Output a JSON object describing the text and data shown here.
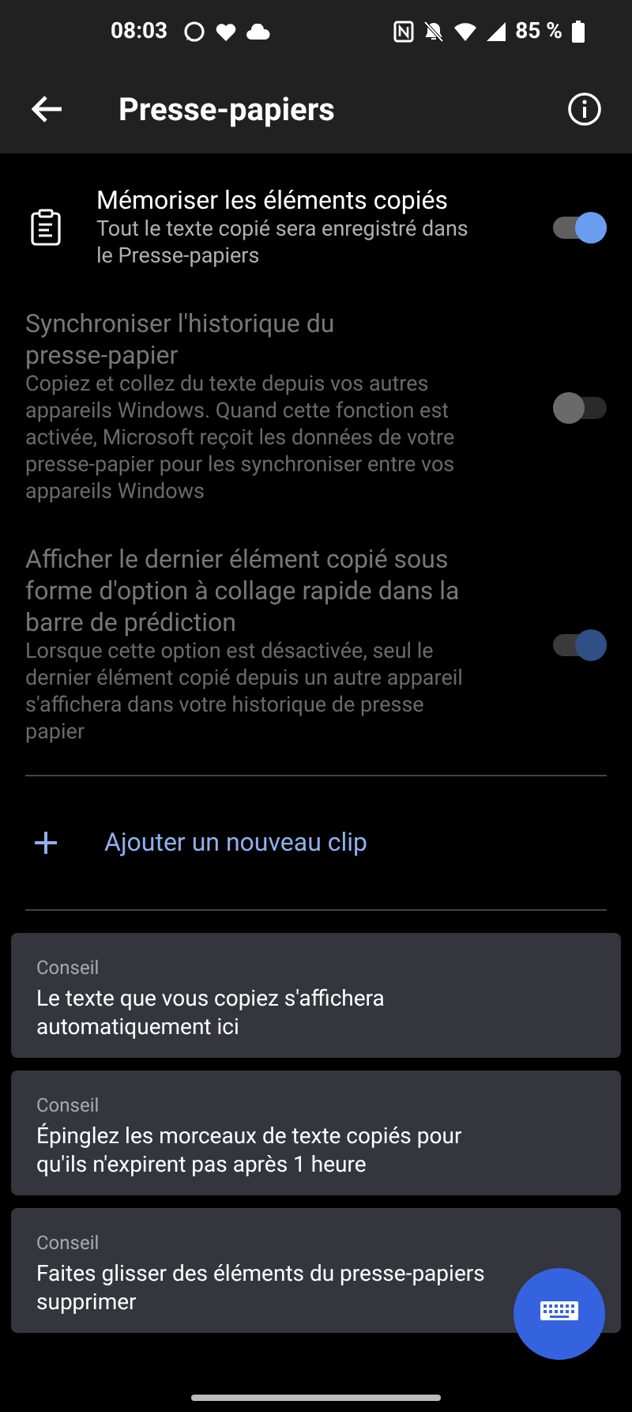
{
  "status_bar": {
    "time": "08:03",
    "battery": "85 %"
  },
  "header": {
    "title": "Presse-papiers"
  },
  "settings": [
    {
      "title": "Mémoriser les éléments copiés",
      "description": "Tout le texte copié sera enregistré dans le Presse-papiers",
      "on": true,
      "disabled": false,
      "has_icon": true
    },
    {
      "title": "Synchroniser l'historique du presse-papier",
      "description": "Copiez et collez du texte depuis vos autres appareils Windows. Quand cette fonction est activée, Microsoft reçoit les données de votre presse-papier pour les synchroniser entre vos appareils Windows",
      "on": false,
      "disabled": true,
      "has_icon": false
    },
    {
      "title": "Afficher le dernier élément copié sous forme d'option à collage rapide dans la barre de prédiction",
      "description": "Lorsque cette option est désactivée, seul le dernier élément copié depuis un autre appareil s'affichera dans votre historique de presse papier",
      "on": true,
      "disabled": true,
      "has_icon": false
    }
  ],
  "add_clip": {
    "label": "Ajouter un nouveau clip"
  },
  "tips": [
    {
      "label": "Conseil",
      "lines": [
        "Le texte que vous copiez s'affichera automatiquement ici"
      ]
    },
    {
      "label": "Conseil",
      "lines": [
        "Épinglez les morceaux de texte copiés pour qu'ils n'expirent pas après 1 heure"
      ]
    },
    {
      "label": "Conseil",
      "lines": [
        "Faites glisser des éléments du presse-papiers",
        "supprimer"
      ]
    }
  ]
}
